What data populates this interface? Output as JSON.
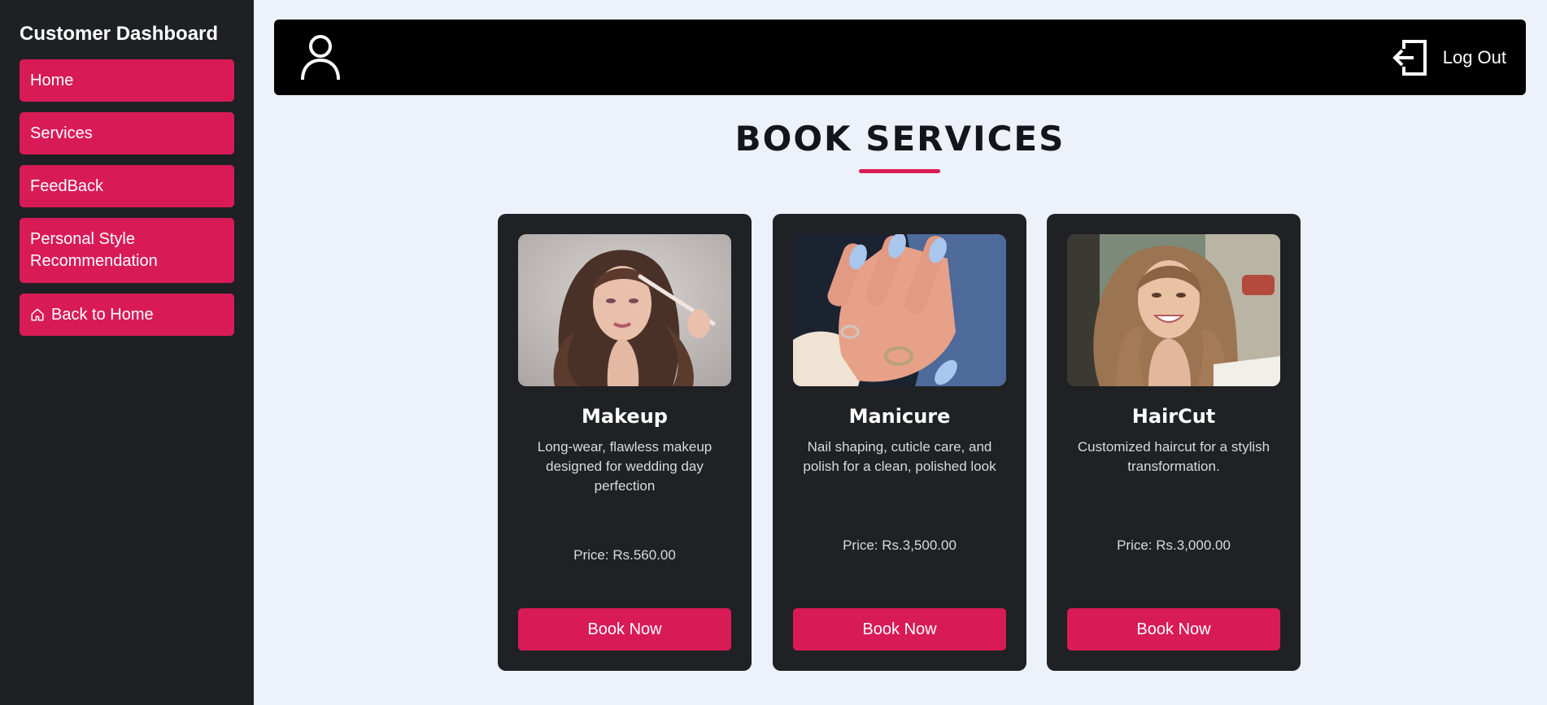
{
  "sidebar": {
    "title": "Customer Dashboard",
    "items": [
      {
        "label": "Home"
      },
      {
        "label": "Services"
      },
      {
        "label": "FeedBack"
      },
      {
        "label": "Personal Style Recommendation"
      },
      {
        "label": "Back to Home",
        "icon": "home-icon"
      }
    ]
  },
  "header": {
    "user_icon": "user-icon",
    "logout_label": "Log Out",
    "logout_icon": "logout-icon"
  },
  "main": {
    "title": "BOOK SERVICES",
    "services": [
      {
        "name": "Makeup",
        "description": "Long-wear, flawless makeup designed for wedding day perfection",
        "price": "Price: Rs.560.00",
        "button": "Book Now"
      },
      {
        "name": "Manicure",
        "description": "Nail shaping, cuticle care, and polish for a clean, polished look",
        "price": "Price: Rs.3,500.00",
        "button": "Book Now"
      },
      {
        "name": "HairCut",
        "description": "Customized haircut for a stylish transformation.",
        "price": "Price: Rs.3,000.00",
        "button": "Book Now"
      }
    ]
  },
  "colors": {
    "accent": "#d81b56",
    "sidebar_bg": "#1f2024",
    "page_bg": "#edf1f9",
    "card_bg": "#202124",
    "topbar_bg": "#000000"
  }
}
